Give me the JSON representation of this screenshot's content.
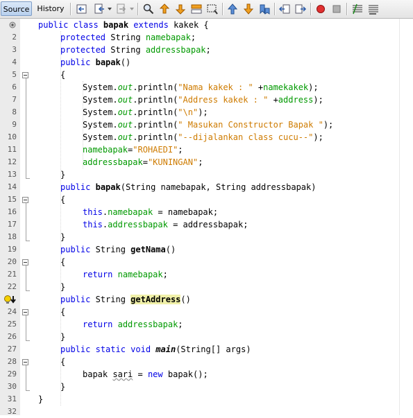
{
  "tabs": {
    "source": "Source",
    "history": "History"
  },
  "toolbar_icons": [
    "last-edit-icon",
    "back-icon",
    "forward-icon",
    "find-icon",
    "find-previous-icon",
    "find-next-icon",
    "toggle-highlight-icon",
    "find-selection-icon",
    "previous-bookmark-icon",
    "next-bookmark-icon",
    "toggle-bookmark-icon",
    "shift-left-icon",
    "shift-right-icon",
    "start-macro-icon",
    "stop-macro-icon",
    "comment-icon",
    "uncomment-icon"
  ],
  "line_numbers": [
    "2",
    "3",
    "4",
    "5",
    "6",
    "7",
    "8",
    "9",
    "10",
    "11",
    "12",
    "13",
    "14",
    "15",
    "16",
    "17",
    "18",
    "19",
    "20",
    "21",
    "22",
    "24",
    "25",
    "26",
    "27",
    "28",
    "29",
    "30",
    "31",
    "32"
  ],
  "code": {
    "l1_a": "public class ",
    "l1_b": "bapak",
    "l1_c": " extends ",
    "l1_d": "kakek {",
    "l2_a": "protected",
    "l2_b": " String ",
    "l2_c": "namebapak",
    "l2_d": ";",
    "l3_a": "protected",
    "l3_b": " String ",
    "l3_c": "addressbapak",
    "l3_d": ";",
    "l4_a": "public",
    "l4_b": " ",
    "l4_c": "bapak",
    "l4_d": "()",
    "brace_open": "{",
    "brace_close": "}",
    "class_close": "}",
    "l6_a": "System.",
    "l6_b": "out",
    "l6_c": ".println(",
    "l6_d": "\"Nama kakek : \"",
    "l6_e": " +",
    "l6_f": "namekakek",
    "l6_g": ");",
    "l7_a": "System.",
    "l7_b": "out",
    "l7_c": ".println(",
    "l7_d": "\"Address kakek : \"",
    "l7_e": " +",
    "l7_f": "address",
    "l7_g": ");",
    "l8_a": "System.",
    "l8_b": "out",
    "l8_c": ".println(",
    "l8_d": "\"\\n\"",
    "l8_e": ");",
    "l9_a": "System.",
    "l9_b": "out",
    "l9_c": ".println(",
    "l9_d": "\" Masukan Constructor Bapak \"",
    "l9_e": ");",
    "l10_a": "System.",
    "l10_b": "out",
    "l10_c": ".println(",
    "l10_d": "\"--dijalankan class cucu--\"",
    "l10_e": ");",
    "l11_a": "namebapak",
    "l11_b": "=",
    "l11_c": "\"ROHAEDI\"",
    "l11_d": ";",
    "l12_a": "addressbapak",
    "l12_b": "=",
    "l12_c": "\"KUNINGAN\"",
    "l12_d": ";",
    "l14_a": "public",
    "l14_b": " ",
    "l14_c": "bapak",
    "l14_d": "(String namebapak, String addressbapak)",
    "l16_a": "this",
    "l16_b": ".",
    "l16_c": "namebapak",
    "l16_d": " = namebapak;",
    "l17_a": "this",
    "l17_b": ".",
    "l17_c": "addressbapak",
    "l17_d": " = addressbapak;",
    "l19_a": "public",
    "l19_b": " String ",
    "l19_c": "getNama",
    "l19_d": "()",
    "l21_a": "return",
    "l21_b": " ",
    "l21_c": "namebapak",
    "l21_d": ";",
    "l23_a": "public",
    "l23_b": " String ",
    "l23_c": "getAddress",
    "l23_d": "()",
    "l25_a": "return",
    "l25_b": " ",
    "l25_c": "addressbapak",
    "l25_d": ";",
    "l27_a": "public static void",
    "l27_b": " ",
    "l27_c": "main",
    "l27_d": "(String[] args)",
    "l29_a": "bapak ",
    "l29_b": "sari",
    "l29_c": " = ",
    "l29_d": "new",
    "l29_e": " bapak();"
  },
  "colors": {
    "keyword": "#0000e6",
    "field": "#009900",
    "string": "#ce7b00",
    "highlight": "#f0f0a8"
  }
}
